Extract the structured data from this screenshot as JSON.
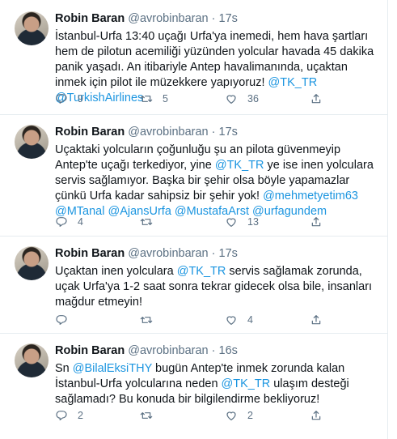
{
  "tweets": [
    {
      "name": "Robin Baran",
      "handle": "@avrobinbaran",
      "separator": "·",
      "time": "17s",
      "text_parts": [
        {
          "t": "İstanbul-Urfa 13:40 uçağı Urfa'ya inemedi, hem hava şartları hem de pilotun acemiliği yüzünden yolcular havada 45 dakika panik yaşadı. An itibariyle Antep havalimanında, uçaktan inmek için pilot ile müzekkere yapıyoruz! "
        },
        {
          "t": "@TK_TR",
          "link": true
        },
        {
          "t": " "
        },
        {
          "t": "@TurkishAirlines",
          "link": true
        }
      ],
      "replies": "9",
      "retweets": "5",
      "likes": "36"
    },
    {
      "name": "Robin Baran",
      "handle": "@avrobinbaran",
      "separator": "·",
      "time": "17s",
      "text_parts": [
        {
          "t": "Uçaktaki yolcuların çoğunluğu şu an pilota güvenmeyip Antep'te uçağı terkediyor, yine "
        },
        {
          "t": "@TK_TR",
          "link": true
        },
        {
          "t": " ye ise inen yolculara servis sağlamıyor. Başka bir şehir olsa böyle yapamazlar çünkü Urfa kadar sahipsiz bir şehir yok! "
        },
        {
          "t": "@mehmetyetim63",
          "link": true
        },
        {
          "t": " "
        },
        {
          "t": "@MTanal",
          "link": true
        },
        {
          "t": " "
        },
        {
          "t": "@AjansUrfa",
          "link": true
        },
        {
          "t": " "
        },
        {
          "t": "@MustafaArst",
          "link": true
        },
        {
          "t": " "
        },
        {
          "t": "@urfagundem",
          "link": true
        }
      ],
      "replies": "4",
      "retweets": "",
      "likes": "13"
    },
    {
      "name": "Robin Baran",
      "handle": "@avrobinbaran",
      "separator": "·",
      "time": "17s",
      "text_parts": [
        {
          "t": "Uçaktan inen yolculara "
        },
        {
          "t": "@TK_TR",
          "link": true
        },
        {
          "t": " servis sağlamak zorunda, uçak Urfa'ya 1-2 saat sonra tekrar gidecek olsa bile, insanları mağdur etmeyin!"
        }
      ],
      "replies": "",
      "retweets": "",
      "likes": "4"
    },
    {
      "name": "Robin Baran",
      "handle": "@avrobinbaran",
      "separator": "·",
      "time": "16s",
      "text_parts": [
        {
          "t": "Sn "
        },
        {
          "t": "@BilalEksiTHY",
          "link": true
        },
        {
          "t": " bugün Antep'te inmek zorunda kalan İstanbul-Urfa yolcularına neden "
        },
        {
          "t": "@TK_TR",
          "link": true
        },
        {
          "t": " ulaşım desteği sağlamadı? Bu konuda bir bilgilendirme bekliyoruz!"
        }
      ],
      "replies": "2",
      "retweets": "",
      "likes": "2"
    }
  ],
  "icons": {
    "reply": "reply-icon",
    "retweet": "retweet-icon",
    "like": "heart-icon",
    "share": "share-icon"
  },
  "colors": {
    "link": "#1b95e0",
    "meta": "#5b7083",
    "divider": "#e6ecf0"
  }
}
